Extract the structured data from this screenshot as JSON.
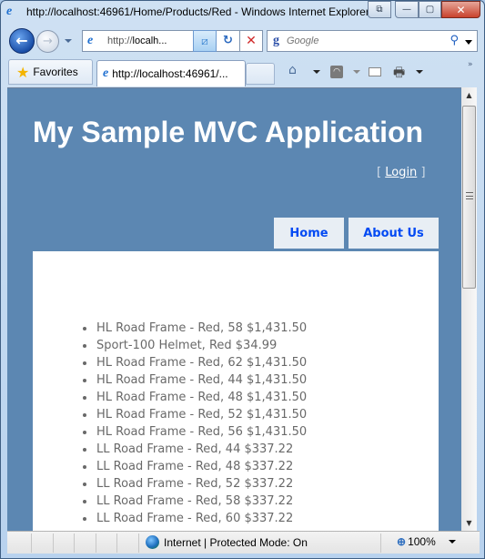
{
  "window": {
    "title": "http://localhost:46961/Home/Products/Red - Windows Internet Explorer",
    "controls": {
      "restore_label": "⧉",
      "minimize_label": "—",
      "maximize_label": "▢",
      "close_label": "✕"
    }
  },
  "navbar": {
    "back_label": "←",
    "forward_label": "→",
    "address_prefix": "http://",
    "address_host": "localh...",
    "refresh_label": "↻",
    "stop_label": "✕",
    "compat_label": "⧄",
    "search_placeholder": "Google",
    "search_engine_icon": "g"
  },
  "tabs": {
    "favorites_label": "Favorites",
    "active_tab_label": "http://localhost:46961/...",
    "more_label": "»",
    "commands": [
      "home-icon",
      "feeds-icon",
      "mail-icon",
      "print-icon"
    ]
  },
  "page": {
    "title": "My Sample MVC Application",
    "login": {
      "open": "[",
      "label": "Login",
      "close": "]"
    },
    "menu": [
      {
        "label": "Home"
      },
      {
        "label": "About Us"
      }
    ],
    "products": [
      "HL Road Frame - Red, 58 $1,431.50",
      "Sport-100 Helmet, Red $34.99",
      "HL Road Frame - Red, 62 $1,431.50",
      "HL Road Frame - Red, 44 $1,431.50",
      "HL Road Frame - Red, 48 $1,431.50",
      "HL Road Frame - Red, 52 $1,431.50",
      "HL Road Frame - Red, 56 $1,431.50",
      "LL Road Frame - Red, 44 $337.22",
      "LL Road Frame - Red, 48 $337.22",
      "LL Road Frame - Red, 52 $337.22",
      "LL Road Frame - Red, 58 $337.22",
      "LL Road Frame - Red, 60 $337.22"
    ]
  },
  "statusbar": {
    "zone": "Internet | Protected Mode: On",
    "zoom": "100%"
  },
  "colors": {
    "page_bg": "#5c87b2",
    "menu_bg": "#e8eef4",
    "menu_text": "#034af3",
    "product_text": "#696969"
  }
}
